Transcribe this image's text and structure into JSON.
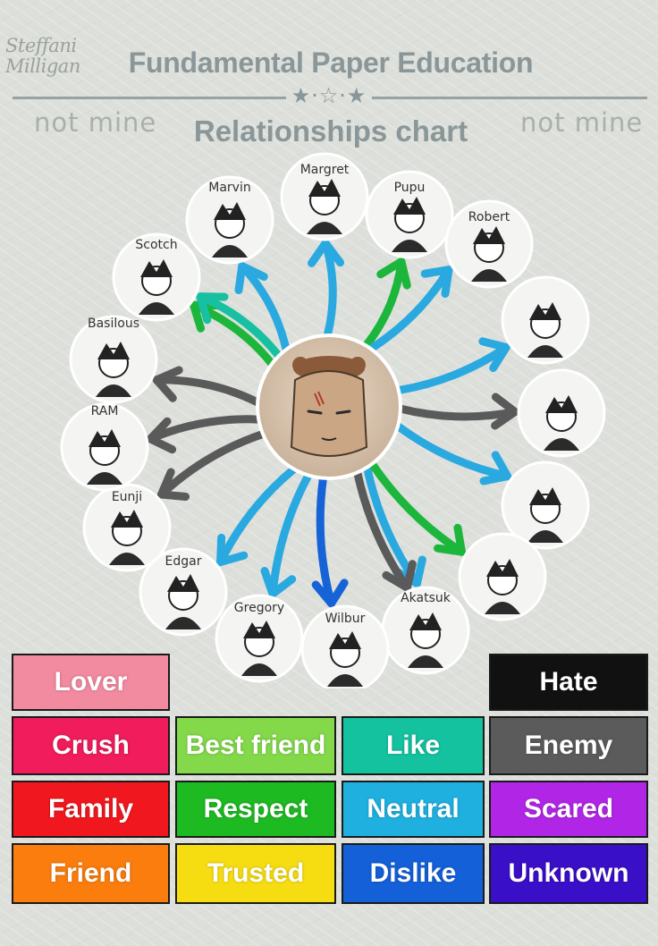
{
  "header": {
    "author_line1": "Steffani",
    "author_line2": "Milligan",
    "title": "Fundamental Paper Education",
    "divider_stars": "★·☆·★",
    "subtitle": "Relationships chart",
    "watermark_left": "not mine",
    "watermark_right": "not mine"
  },
  "center": {
    "icon": "hand-drawn-character-portrait"
  },
  "characters": [
    {
      "label": "Margret"
    },
    {
      "label": "Pupu"
    },
    {
      "label": "Robert"
    },
    {
      "label": ""
    },
    {
      "label": ""
    },
    {
      "label": ""
    },
    {
      "label": ""
    },
    {
      "label": "Akatsuk"
    },
    {
      "label": "Wilbur"
    },
    {
      "label": "Gregory"
    },
    {
      "label": "Edgar"
    },
    {
      "label": "Eunji"
    },
    {
      "label": "RAM"
    },
    {
      "label": "Basilous"
    },
    {
      "label": "Scotch"
    },
    {
      "label": "Marvin"
    }
  ],
  "arrows": [
    {
      "from": "center",
      "to": "Marvin",
      "color": "#2aa9e0"
    },
    {
      "from": "center",
      "to": "Margret",
      "color": "#2aa9e0"
    },
    {
      "from": "center",
      "to": "Pupu",
      "color": "#1bb63b"
    },
    {
      "from": "center",
      "to": "Robert",
      "color": "#2aa9e0"
    },
    {
      "from": "center",
      "to": "Scotch",
      "color": "#1bb63b"
    },
    {
      "from": "center",
      "to": "Scotch",
      "color": "#17c0a0"
    },
    {
      "from": "center",
      "to": "Basilous",
      "color": "#5a5a5a"
    },
    {
      "from": "center",
      "to": "RAM",
      "color": "#5a5a5a"
    },
    {
      "from": "center",
      "to": "Eunji",
      "color": "#5a5a5a"
    },
    {
      "from": "center",
      "to": "Edgar",
      "color": "#2aa9e0"
    },
    {
      "from": "center",
      "to": "Gregory",
      "color": "#2aa9e0"
    },
    {
      "from": "center",
      "to": "Wilbur",
      "color": "#1663d8"
    },
    {
      "from": "center",
      "to": "Akatsuk",
      "color": "#2aa9e0"
    },
    {
      "from": "center",
      "to": "character-7",
      "color": "#5a5a5a"
    },
    {
      "from": "center",
      "to": "character-6",
      "color": "#1bb63b"
    },
    {
      "from": "center",
      "to": "character-5",
      "color": "#2aa9e0"
    },
    {
      "from": "center",
      "to": "character-4",
      "color": "#5a5a5a"
    },
    {
      "from": "center",
      "to": "character-3",
      "color": "#2aa9e0"
    }
  ],
  "legend": [
    {
      "label": "Lover",
      "color": "#f28aa0"
    },
    {
      "label": "Hate",
      "color": "#111111"
    },
    {
      "label": "Crush",
      "color": "#f01c5c"
    },
    {
      "label": "Best friend",
      "color": "#83d94a"
    },
    {
      "label": "Like",
      "color": "#14c2a0"
    },
    {
      "label": "Enemy",
      "color": "#5b5b5b"
    },
    {
      "label": "Family",
      "color": "#f0181e"
    },
    {
      "label": "Respect",
      "color": "#1dba22"
    },
    {
      "label": "Neutral",
      "color": "#1fb0e0"
    },
    {
      "label": "Scared",
      "color": "#b126e6"
    },
    {
      "label": "Friend",
      "color": "#fb7d0e"
    },
    {
      "label": "Trusted",
      "color": "#f6dd12"
    },
    {
      "label": "Dislike",
      "color": "#1460d9"
    },
    {
      "label": "Unknown",
      "color": "#3a0fc8"
    }
  ]
}
